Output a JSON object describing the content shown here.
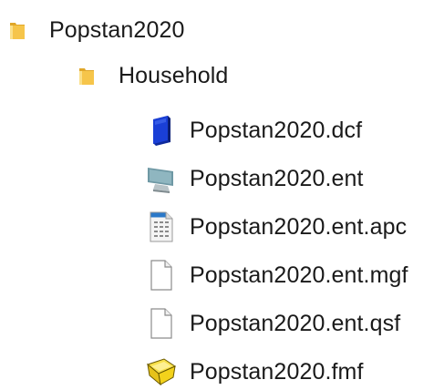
{
  "tree": {
    "root": {
      "label": "Popstan2020",
      "icon": "folder-icon"
    },
    "child_folder": {
      "label": "Household",
      "icon": "folder-icon"
    },
    "files": [
      {
        "label": "Popstan2020.dcf",
        "icon": "dictionary-book-icon",
        "color": "#1a3fd6"
      },
      {
        "label": "Popstan2020.ent",
        "icon": "data-entry-monitor-icon",
        "color": "#5f8a96"
      },
      {
        "label": "Popstan2020.ent.apc",
        "icon": "logic-document-icon",
        "color": "#2a78c8"
      },
      {
        "label": "Popstan2020.ent.mgf",
        "icon": "blank-file-icon",
        "color": "#ffffff"
      },
      {
        "label": "Popstan2020.ent.qsf",
        "icon": "blank-file-icon",
        "color": "#ffffff"
      },
      {
        "label": "Popstan2020.fmf",
        "icon": "form-file-icon",
        "color": "#f3d21b"
      }
    ]
  },
  "colors": {
    "folder": "#f6c54a",
    "folder_dark": "#e0a72a"
  }
}
